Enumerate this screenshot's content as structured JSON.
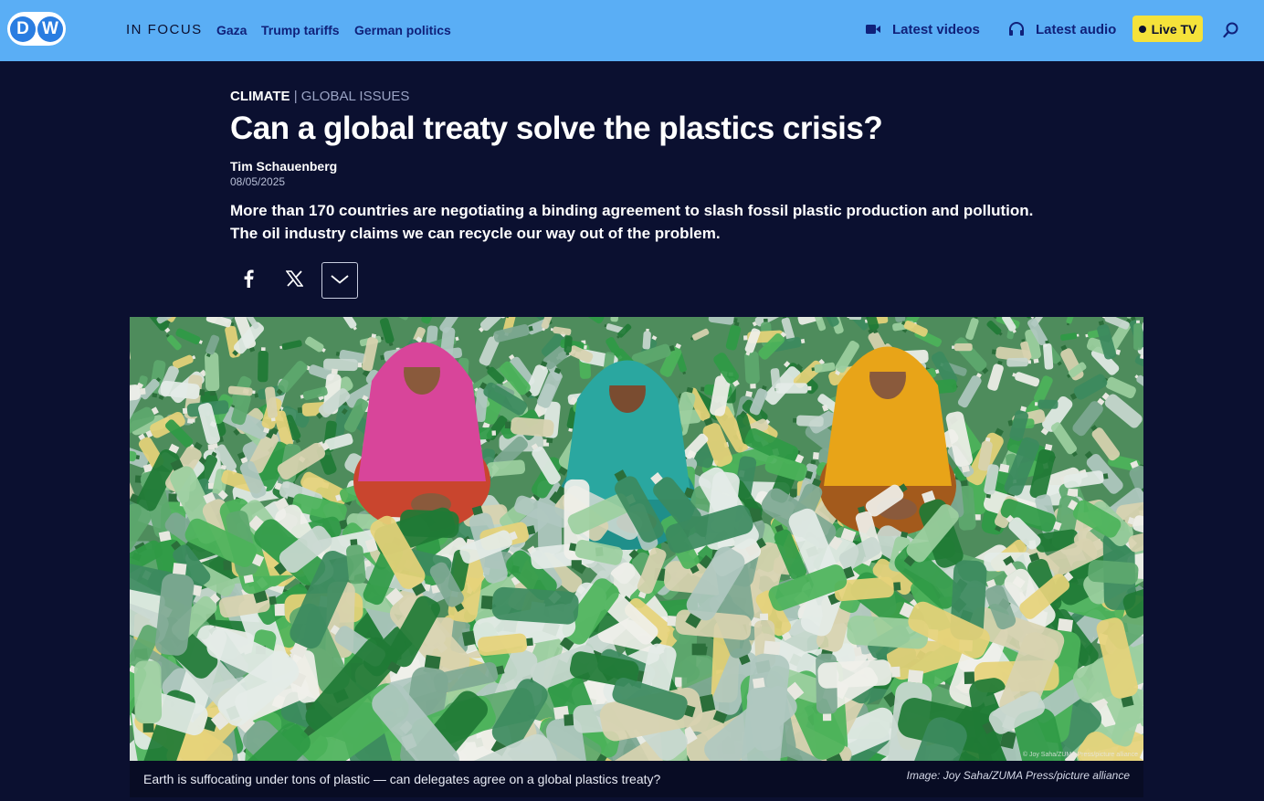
{
  "header": {
    "logo_text": "DW",
    "in_focus_label": "IN FOCUS",
    "focus_links": [
      "Gaza",
      "Trump tariffs",
      "German politics"
    ],
    "latest_videos": "Latest videos",
    "latest_audio": "Latest audio",
    "live_tv": "Live TV",
    "icons": {
      "videos": "video-camera-icon",
      "audio": "headphones-icon",
      "search": "search-icon"
    },
    "colors": {
      "bar": "#5aaef5",
      "live": "#f5e23a",
      "link": "#10217a"
    }
  },
  "article": {
    "category": "CLIMATE",
    "separator": " | ",
    "subcategory": "GLOBAL ISSUES",
    "headline": "Can a global treaty solve the plastics crisis?",
    "author": "Tim Schauenberg",
    "date": "08/05/2025",
    "teaser": "More than 170 countries are negotiating a binding agreement to slash fossil plastic production and pollution. The oil industry claims we can recycle our way out of the problem.",
    "share": [
      {
        "name": "facebook-share-button",
        "icon": "facebook-icon",
        "glyph": "f"
      },
      {
        "name": "x-share-button",
        "icon": "x-icon",
        "glyph": "𝕏"
      },
      {
        "name": "more-share-button",
        "icon": "chevron-down-icon",
        "glyph": "﹀"
      }
    ]
  },
  "image": {
    "caption": "Earth is suffocating under tons of plastic — can delegates agree on a global plastics treaty?",
    "credit": "Image: Joy Saha/ZUMA Press/picture alliance",
    "watermark": "© Joy Saha/ZUMA Press/picture alliance"
  },
  "colors": {
    "page_bg": "#0b1030"
  }
}
